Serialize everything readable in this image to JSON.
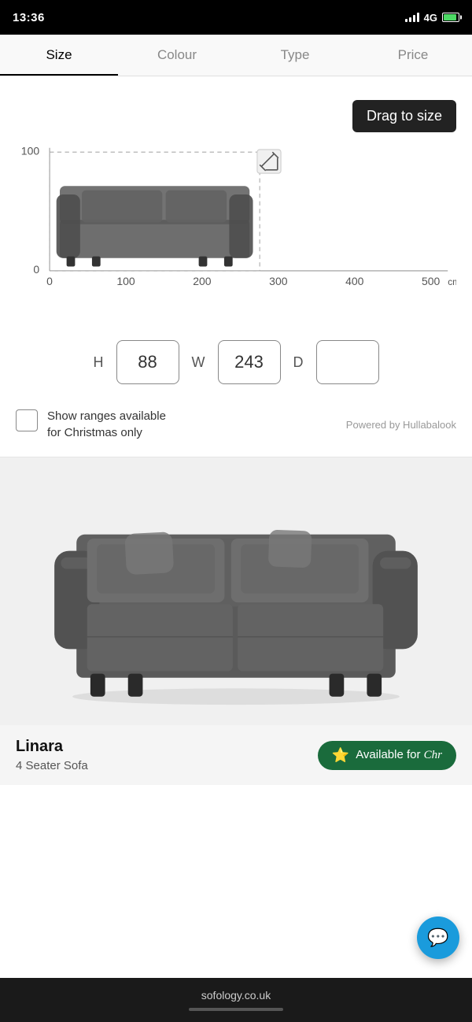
{
  "statusBar": {
    "time": "13:36",
    "network": "4G"
  },
  "tabs": [
    {
      "id": "size",
      "label": "Size",
      "active": true
    },
    {
      "id": "colour",
      "label": "Colour",
      "active": false
    },
    {
      "id": "type",
      "label": "Type",
      "active": false
    },
    {
      "id": "price",
      "label": "Price",
      "active": false
    }
  ],
  "visualizer": {
    "dragTooltip": "Drag to size",
    "xAxisLabels": [
      "0",
      "100",
      "200",
      "300",
      "400",
      "500"
    ],
    "xAxisUnit": "cm",
    "yAxisLabels": [
      "100",
      "0"
    ]
  },
  "dimensions": {
    "hLabel": "H",
    "wLabel": "W",
    "dLabel": "D",
    "hValue": "88",
    "wValue": "243",
    "dValue": ""
  },
  "checkbox": {
    "label": "Show ranges available\nfor Christmas only",
    "poweredBy": "Powered by Hullabalook"
  },
  "product": {
    "name": "Linara",
    "type": "4 Seater Sofa",
    "christmasBadge": "Available for Chr...",
    "christmasIcon": "⭐"
  },
  "bottomBar": {
    "url": "sofology.co.uk"
  },
  "chat": {
    "icon": "💬"
  }
}
